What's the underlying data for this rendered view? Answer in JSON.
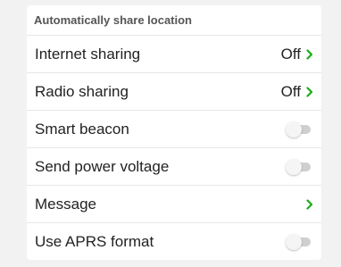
{
  "section": {
    "title": "Automatically share location"
  },
  "rows": [
    {
      "label": "Internet sharing",
      "value": "Off",
      "control": "chevron"
    },
    {
      "label": "Radio sharing",
      "value": "Off",
      "control": "chevron"
    },
    {
      "label": "Smart beacon",
      "control": "toggle",
      "on": false
    },
    {
      "label": "Send power voltage",
      "control": "toggle",
      "on": false
    },
    {
      "label": "Message",
      "control": "chevron"
    },
    {
      "label": "Use APRS format",
      "control": "toggle",
      "on": false
    }
  ],
  "colors": {
    "accent_chevron": "#1aad19",
    "toggle_off_track": "#cfcfcf"
  }
}
